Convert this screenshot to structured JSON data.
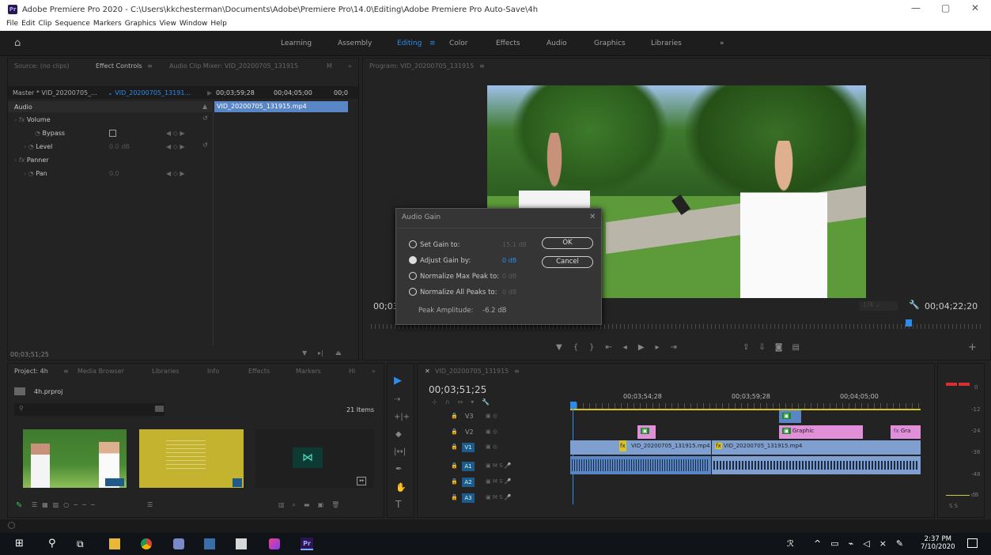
{
  "window": {
    "title": "Adobe Premiere Pro 2020 - C:\\Users\\kkchesterman\\Documents\\Adobe\\Premiere Pro\\14.0\\Editing\\Adobe Premiere Pro Auto-Save\\4h",
    "app_icon": "Pr"
  },
  "menu": [
    "File",
    "Edit",
    "Clip",
    "Sequence",
    "Markers",
    "Graphics",
    "View",
    "Window",
    "Help"
  ],
  "workspaces": [
    "Learning",
    "Assembly",
    "Editing",
    "Color",
    "Effects",
    "Audio",
    "Graphics",
    "Libraries"
  ],
  "active_workspace": "Editing",
  "source_panel": {
    "tabs": [
      "Source: (no clips)",
      "Effect Controls",
      "Audio Clip Mixer: VID_20200705_131915",
      "M"
    ],
    "master": "Master * VID_20200705_...",
    "clip": "VID_20200705_13191...",
    "tc1": "00;03;59;28",
    "tc2": "00;04;05;00",
    "tc3": "00;0",
    "clip_bar": "VID_20200705_131915.mp4",
    "section": "Audio",
    "rows": [
      {
        "label": "Volume",
        "value": ""
      },
      {
        "label": "Bypass",
        "value": ""
      },
      {
        "label": "Level",
        "value": "0.0 dB"
      },
      {
        "label": "Panner",
        "value": ""
      },
      {
        "label": "Pan",
        "value": "0.0"
      }
    ],
    "timecode": "00;03;51;25"
  },
  "program": {
    "tab": "Program: VID_20200705_131915",
    "timecode_left": "00;03",
    "fit": "1/4",
    "timecode_right": "00;04;22;20"
  },
  "dialog": {
    "title": "Audio Gain",
    "options": [
      {
        "label": "Set Gain to:",
        "value": "15.1 dB"
      },
      {
        "label": "Adjust Gain by:",
        "value": "0 dB"
      },
      {
        "label": "Normalize Max Peak to:",
        "value": "0 dB"
      },
      {
        "label": "Normalize All Peaks to:",
        "value": "0 dB"
      }
    ],
    "peak_label": "Peak Amplitude:",
    "peak_value": "-6.2 dB",
    "ok": "OK",
    "cancel": "Cancel"
  },
  "project": {
    "tabs": [
      "Project: 4h",
      "Media Browser",
      "Libraries",
      "Info",
      "Effects",
      "Markers",
      "Hi"
    ],
    "file": "4h.prproj",
    "items": "21 Items"
  },
  "timeline": {
    "tab": "VID_20200705_131915",
    "timecode": "00;03;51;25",
    "ruler": [
      "00;03;54;28",
      "00;03;59;28",
      "00;04;05;00"
    ],
    "tracks": [
      "V3",
      "V2",
      "V1",
      "A1",
      "A2",
      "A3"
    ],
    "clips": {
      "v1a": "VID_20200705_131915.mp4",
      "v1b": "VID_20200705_131915.mp4",
      "v2": "Graphic",
      "v2b": "Gra"
    }
  },
  "meter": {
    "labels": [
      "0",
      "-12",
      "-24",
      "-36",
      "-48",
      "dB"
    ],
    "solo": "S S"
  },
  "taskbar": {
    "time": "2:37 PM",
    "date": "7/10/2020"
  }
}
